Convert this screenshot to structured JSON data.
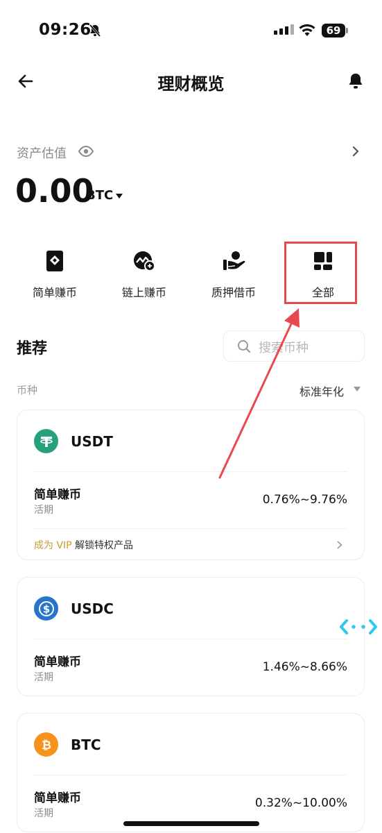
{
  "status_bar": {
    "time": "09:26",
    "battery": "69"
  },
  "header": {
    "title": "理财概览"
  },
  "asset": {
    "label": "资产估值",
    "value": "0.00",
    "unit": "BTC"
  },
  "entries": [
    {
      "label": "简单赚币",
      "icon": "simple-earn-icon"
    },
    {
      "label": "链上赚币",
      "icon": "onchain-earn-icon"
    },
    {
      "label": "质押借币",
      "icon": "pledge-loan-icon"
    },
    {
      "label": "全部",
      "icon": "all-grid-icon"
    }
  ],
  "recommend": {
    "title": "推荐",
    "search_placeholder": "搜索币种",
    "col_coin": "币种",
    "col_apr": "标准年化"
  },
  "cards": [
    {
      "coin": "USDT",
      "product": "简单赚币",
      "term": "活期",
      "rate": "0.76%~9.76%",
      "vip_prefix": "成为 VIP",
      "vip_text": " 解锁特权产品",
      "color": "#26a17b"
    },
    {
      "coin": "USDC",
      "product": "简单赚币",
      "term": "活期",
      "rate": "1.46%~8.66%",
      "color": "#2775ca"
    },
    {
      "coin": "BTC",
      "product": "简单赚币",
      "term": "活期",
      "rate": "0.32%~10.00%",
      "color": "#f7931a"
    }
  ],
  "colors": {
    "annotation": "#e8484f",
    "vip_gold": "#c99b2e"
  }
}
